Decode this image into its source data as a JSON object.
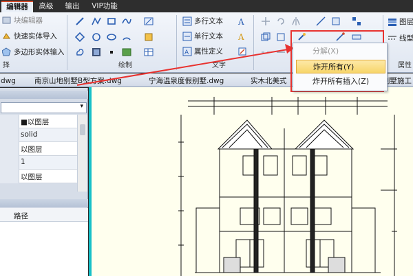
{
  "menu": {
    "tabs": [
      {
        "label": "编辑器",
        "active": true
      },
      {
        "label": "高级",
        "active": false
      },
      {
        "label": "输出",
        "active": false
      },
      {
        "label": "VIP功能",
        "active": false
      }
    ]
  },
  "ribbon": {
    "block_editor": "块编辑器",
    "quick_entity_import": "快速实体导入",
    "polygon_entity_input": "多边形实体输入",
    "group_left_label": "择",
    "group_draw_label": "绘制",
    "group_text_label": "文字",
    "multiline_text": "多行文本",
    "single_line_text": "单行文本",
    "attribute_definition": "属性定义",
    "right_item_1": "图层",
    "right_item_2": "线型",
    "group_right_label": "属性"
  },
  "doc_tabs": [
    {
      "label": "dwg"
    },
    {
      "label": "南京山地别墅B型方案.dwg"
    },
    {
      "label": "宁海温泉度假别墅.dwg"
    },
    {
      "label": "实木北美式"
    },
    {
      "label": "别墅施工"
    }
  ],
  "properties": {
    "rows": [
      {
        "value": "■以图层"
      },
      {
        "value": "solid"
      },
      {
        "value": "以图层"
      },
      {
        "value": "1"
      },
      {
        "value": "以图层"
      }
    ]
  },
  "bottom_panel": {
    "column_path": "路径"
  },
  "dropdown": {
    "items": [
      {
        "label": "分解(X)",
        "disabled": true
      },
      {
        "label": "炸开所有(Y)",
        "highlighted": true
      },
      {
        "label": "炸开所有插入(Z)",
        "disabled": false
      }
    ]
  },
  "colors": {
    "annotation_red": "#e8322f",
    "canvas_bg": "#ffffee",
    "highlight": "#f7d56a",
    "canvas_frame": "#17c0c8"
  }
}
